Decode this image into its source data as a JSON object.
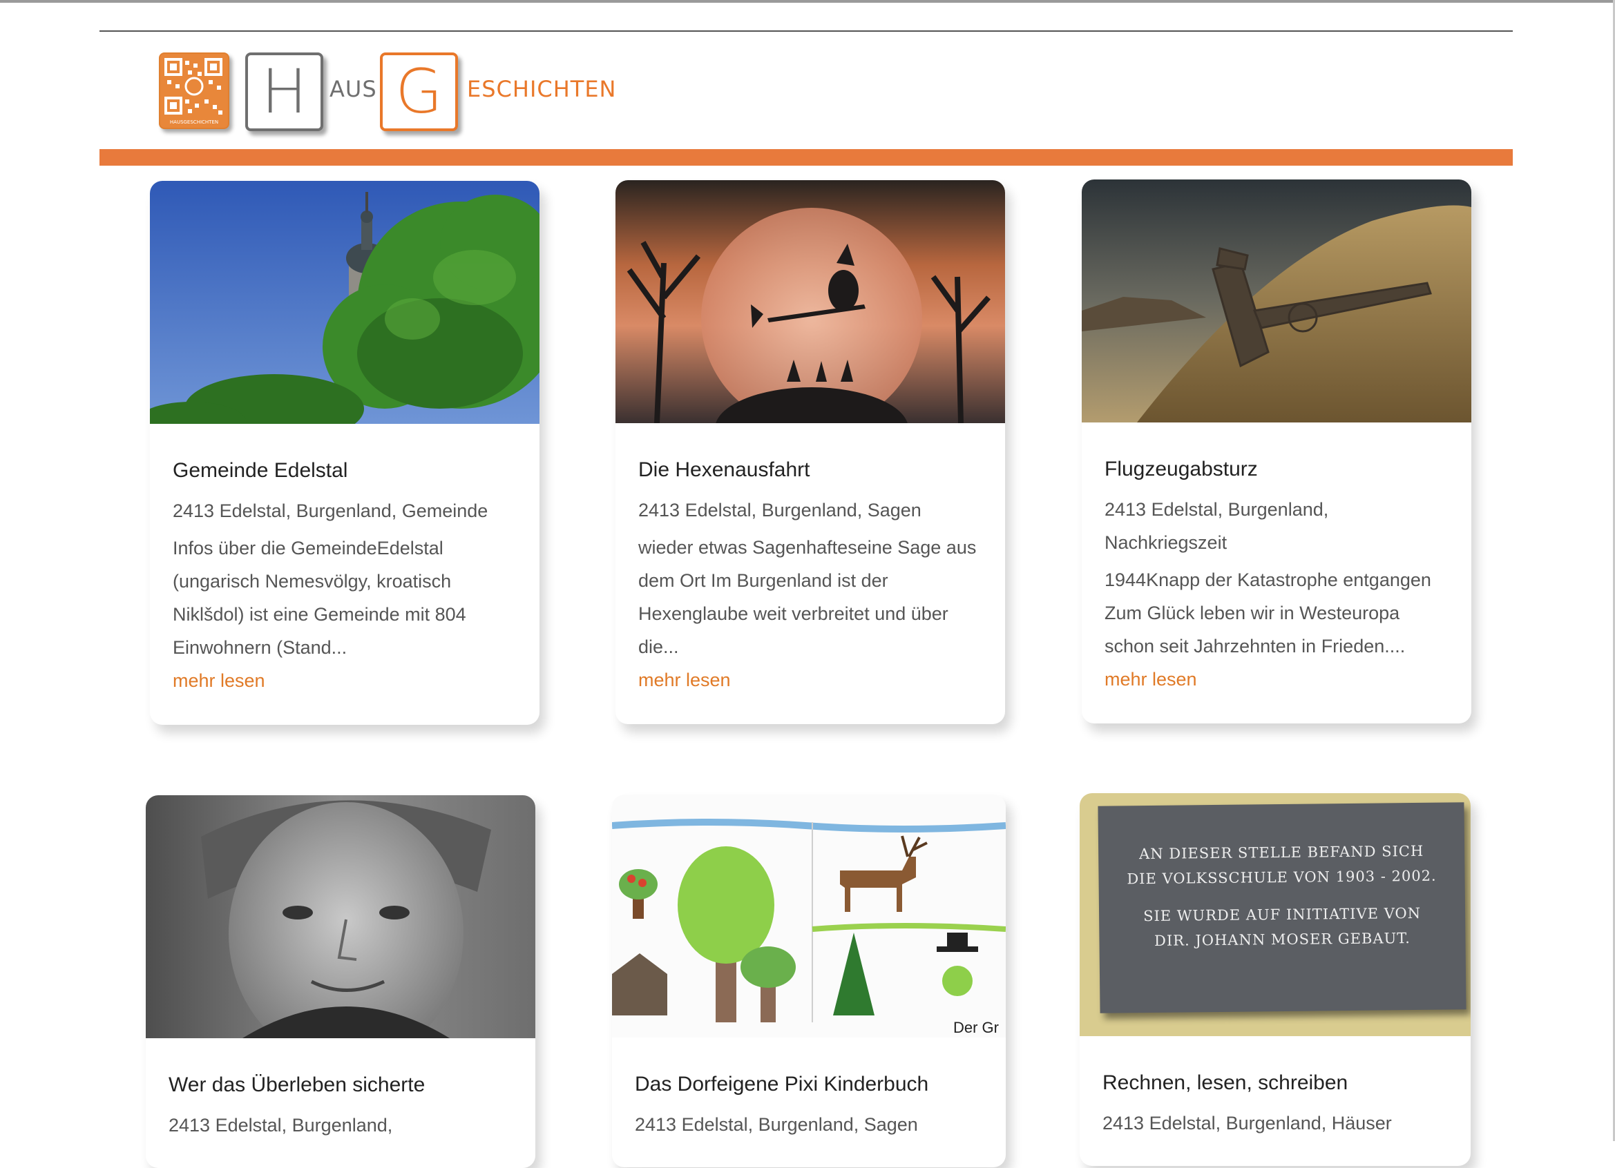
{
  "header": {
    "logo": {
      "qr_caption": "HAUSGESCHICHTEN",
      "letter_h": "H",
      "word_aus": "AUS",
      "letter_g": "G",
      "word_eschichten": "ESCHICHTEN"
    }
  },
  "colors": {
    "accent": "#e87a3c",
    "logo_grey": "#6f6f6f",
    "link": "#e07a27"
  },
  "cards": [
    {
      "image_icon": "church-tower-photo",
      "title": "Gemeinde Edelstal",
      "meta": "2413 Edelstal, Burgenland, Gemeinde",
      "excerpt": "Infos über die GemeindeEdelstal (ungarisch Nemesvölgy, kroatisch Niklšdol) ist eine Gemeinde mit 804 Einwohnern (Stand...",
      "link": "mehr lesen"
    },
    {
      "image_icon": "witch-sunset-painting",
      "title": "Die Hexenausfahrt",
      "meta": "2413 Edelstal, Burgenland, Sagen",
      "excerpt": "wieder etwas Sagenhafteseine Sage aus dem Ort   Im Burgenland ist der Hexenglaube weit verbreitet und über die...",
      "link": "mehr lesen"
    },
    {
      "image_icon": "plane-wreck-photo",
      "title": "Flugzeugabsturz",
      "meta": "2413 Edelstal, Burgenland, Nachkriegszeit",
      "excerpt": "1944Knapp der Katastrophe entgangen    Zum Glück leben wir in Westeuropa schon seit Jahrzehnten in Frieden....",
      "link": "mehr lesen"
    },
    {
      "image_icon": "elderly-woman-portrait",
      "title": "Wer das Überleben sicherte",
      "meta": "2413 Edelstal, Burgenland,"
    },
    {
      "image_icon": "children-drawing",
      "image_caption": "Der Gr",
      "title": "Das Dorfeigene Pixi Kinderbuch",
      "meta": "2413 Edelstal, Burgenland, Sagen"
    },
    {
      "image_icon": "memorial-plaque-photo",
      "plaque_lines": [
        "AN DIESER STELLE BEFAND SICH",
        "DIE VOLKSSCHULE VON 1903 - 2002.",
        "SIE WURDE AUF INITIATIVE VON",
        "DIR. JOHANN MOSER GEBAUT."
      ],
      "title": "Rechnen, lesen, schreiben",
      "meta": "2413 Edelstal, Burgenland, Häuser"
    }
  ]
}
